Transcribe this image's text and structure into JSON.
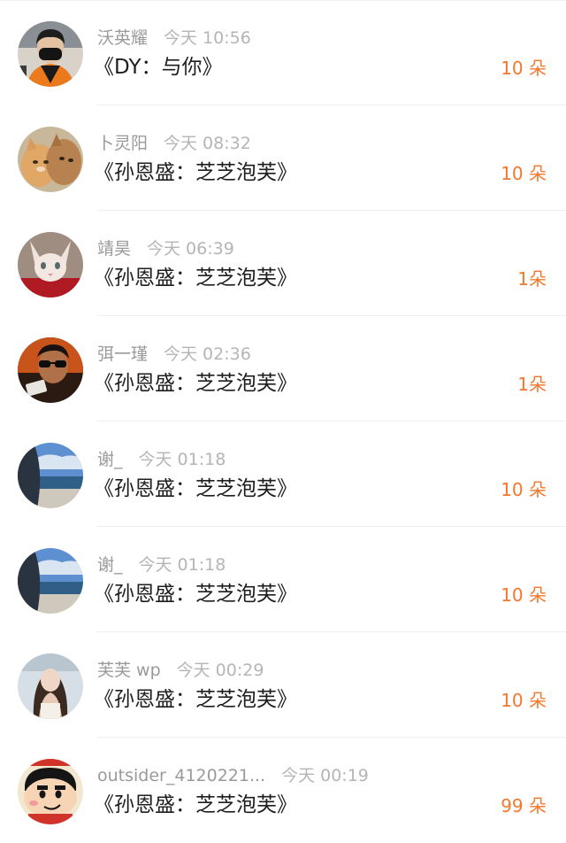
{
  "gifts": [
    {
      "username": "沃英耀",
      "time": "今天 10:56",
      "title": "《DY：与你》",
      "amount": "10 朵",
      "avatar": "avatar-person-mask-icon"
    },
    {
      "username": "卜灵阳",
      "time": "今天 08:32",
      "title": "《孙恩盛：芝芝泡芙》",
      "amount": "10 朵",
      "avatar": "avatar-kittens-icon"
    },
    {
      "username": "靖昊",
      "time": "今天 06:39",
      "title": "《孙恩盛：芝芝泡芙》",
      "amount": "1朵",
      "avatar": "avatar-hairless-cat-icon"
    },
    {
      "username": "弭一瑾",
      "time": "今天 02:36",
      "title": "《孙恩盛：芝芝泡芙》",
      "amount": "1朵",
      "avatar": "avatar-sunglasses-man-icon"
    },
    {
      "username": "谢_",
      "time": "今天 01:18",
      "title": "《孙恩盛：芝芝泡芙》",
      "amount": "10 朵",
      "avatar": "avatar-beach-icon"
    },
    {
      "username": "谢_",
      "time": "今天 01:18",
      "title": "《孙恩盛：芝芝泡芙》",
      "amount": "10 朵",
      "avatar": "avatar-beach-icon"
    },
    {
      "username": "芙芙 wp",
      "time": "今天 00:29",
      "title": "《孙恩盛：芝芝泡芙》",
      "amount": "10 朵",
      "avatar": "avatar-girl-icon"
    },
    {
      "username": "outsider_4120221...",
      "time": "今天 00:19",
      "title": "《孙恩盛：芝芝泡芙》",
      "amount": "99 朵",
      "avatar": "avatar-cartoon-boy-icon"
    }
  ],
  "colors": {
    "accent": "#f5772d",
    "username": "#9a9a9a",
    "time": "#b5b5b5",
    "title": "#1e1e1e"
  }
}
